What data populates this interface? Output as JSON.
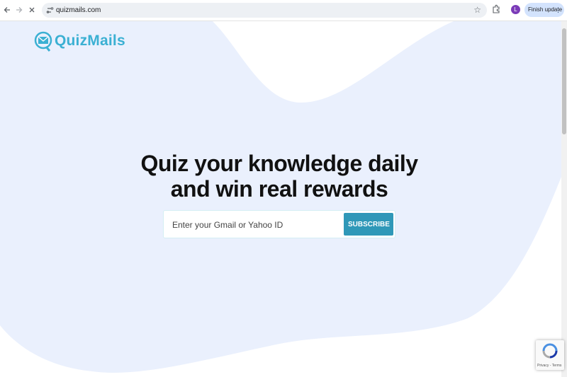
{
  "browser": {
    "url": "quizmails.com",
    "update_label": "Finish update",
    "profile_initial": "L"
  },
  "site": {
    "logo_text": "QuizMails",
    "headline_line1": "Quiz your knowledge daily",
    "headline_line2": "and win real rewards",
    "email_placeholder": "Enter your Gmail or Yahoo ID",
    "subscribe_label": "SUBSCRIBE",
    "recaptcha_text": "Privacy - Terms"
  },
  "colors": {
    "brand": "#3bb0d3",
    "button": "#2f98b8",
    "hero_bg": "#eaf0fd"
  }
}
